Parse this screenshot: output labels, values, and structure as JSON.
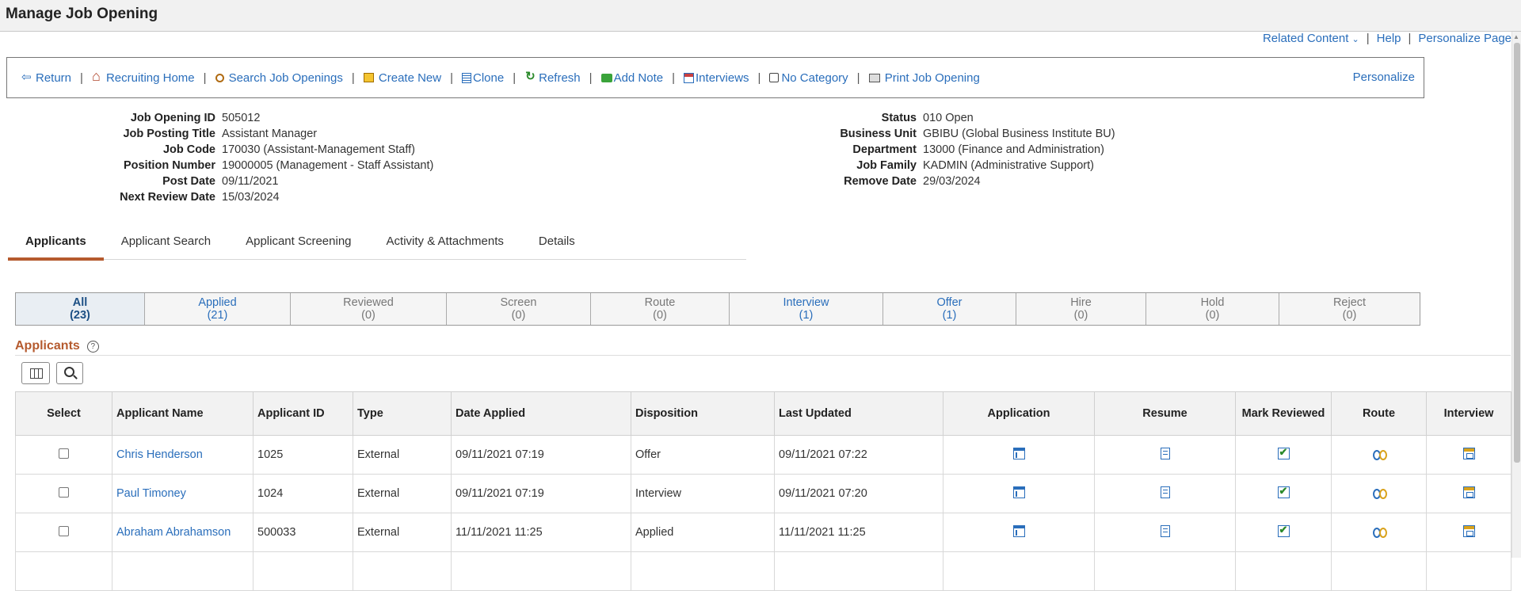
{
  "page": {
    "title": "Manage Job Opening"
  },
  "related": {
    "related_content": "Related Content",
    "help": "Help",
    "personalize_page": "Personalize Page",
    "sep": "|"
  },
  "toolbar": {
    "items": [
      {
        "label": "Return",
        "icon": "return-icon"
      },
      {
        "label": "Recruiting Home",
        "icon": "home-icon"
      },
      {
        "label": "Search Job Openings",
        "icon": "search-icon"
      },
      {
        "label": "Create New",
        "icon": "create-icon"
      },
      {
        "label": "Clone",
        "icon": "clone-icon"
      },
      {
        "label": "Refresh",
        "icon": "refresh-icon"
      },
      {
        "label": "Add Note",
        "icon": "note-icon"
      },
      {
        "label": "Interviews",
        "icon": "calendar-icon"
      },
      {
        "label": "No Category",
        "icon": "category-icon"
      },
      {
        "label": "Print Job Opening",
        "icon": "print-icon"
      }
    ],
    "sep": "|",
    "personalize": "Personalize"
  },
  "job_info": {
    "left": [
      {
        "label": "Job Opening ID",
        "value": "505012"
      },
      {
        "label": "Job Posting Title",
        "value": "Assistant Manager"
      },
      {
        "label": "Job Code",
        "value": "170030 (Assistant-Management Staff)"
      },
      {
        "label": "Position Number",
        "value": "19000005 (Management - Staff Assistant)"
      },
      {
        "label": "Post Date",
        "value": "09/11/2021"
      },
      {
        "label": "Next Review Date",
        "value": "15/03/2024"
      }
    ],
    "right": [
      {
        "label": "Status",
        "value": "010 Open"
      },
      {
        "label": "Business Unit",
        "value": "GBIBU (Global Business Institute BU)"
      },
      {
        "label": "Department",
        "value": "13000 (Finance and Administration)"
      },
      {
        "label": "Job Family",
        "value": "KADMIN (Administrative Support)"
      },
      {
        "label": "Remove Date",
        "value": "29/03/2024"
      }
    ]
  },
  "tabs": [
    "Applicants",
    "Applicant Search",
    "Applicant Screening",
    "Activity & Attachments",
    "Details"
  ],
  "status_filters": [
    {
      "label": "All",
      "count": "(23)"
    },
    {
      "label": "Applied",
      "count": "(21)"
    },
    {
      "label": "Reviewed",
      "count": "(0)"
    },
    {
      "label": "Screen",
      "count": "(0)"
    },
    {
      "label": "Route",
      "count": "(0)"
    },
    {
      "label": "Interview",
      "count": "(1)"
    },
    {
      "label": "Offer",
      "count": "(1)"
    },
    {
      "label": "Hire",
      "count": "(0)"
    },
    {
      "label": "Hold",
      "count": "(0)"
    },
    {
      "label": "Reject",
      "count": "(0)"
    }
  ],
  "grid": {
    "title": "Applicants",
    "help_glyph": "?",
    "columns": [
      "Select",
      "Applicant Name",
      "Applicant ID",
      "Type",
      "Date Applied",
      "Disposition",
      "Last Updated",
      "Application",
      "Resume",
      "Mark Reviewed",
      "Route",
      "Interview"
    ],
    "rows": [
      {
        "name": "Chris Henderson",
        "id": "1025",
        "type": "External",
        "date_applied": "09/11/2021 07:19",
        "disposition": "Offer",
        "last_updated": "09/11/2021 07:22"
      },
      {
        "name": "Paul Timoney",
        "id": "1024",
        "type": "External",
        "date_applied": "09/11/2021 07:19",
        "disposition": "Interview",
        "last_updated": "09/11/2021 07:20"
      },
      {
        "name": "Abraham Abrahamson",
        "id": "500033",
        "type": "External",
        "date_applied": "11/11/2021 11:25",
        "disposition": "Applied",
        "last_updated": "11/11/2021 11:25"
      },
      {
        "name": "",
        "id": "",
        "type": "",
        "date_applied": "",
        "disposition": "",
        "last_updated": ""
      }
    ]
  }
}
